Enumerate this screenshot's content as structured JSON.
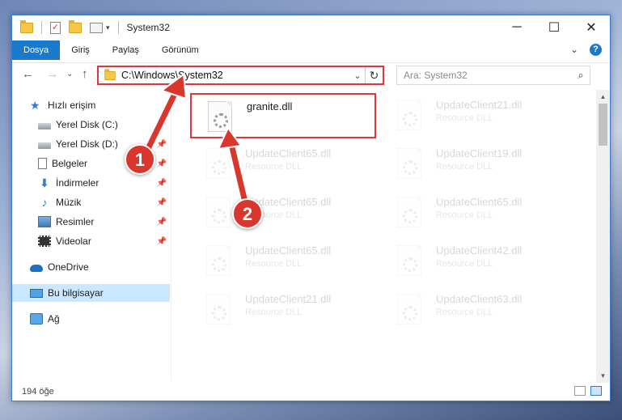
{
  "titlebar": {
    "title": "System32",
    "minimize": "─",
    "maximize": "☐",
    "close": "✕"
  },
  "ribbon": {
    "tabs": [
      "Dosya",
      "Giriş",
      "Paylaş",
      "Görünüm"
    ],
    "expand": "⌄",
    "help": "?"
  },
  "nav": {
    "back": "←",
    "forward": "→",
    "recent": "⌄",
    "up": "↑",
    "address": "C:\\Windows\\System32",
    "refresh": "↻",
    "search_placeholder": "Ara: System32",
    "search_icon": "⌕"
  },
  "sidebar": {
    "items": [
      {
        "label": "Hızlı erişim",
        "icon": "star-icon"
      },
      {
        "label": "Yerel Disk (C:)",
        "icon": "drive-icon"
      },
      {
        "label": "Yerel Disk (D:)",
        "icon": "drive-icon"
      },
      {
        "label": "Belgeler",
        "icon": "document-icon"
      },
      {
        "label": "İndirmeler",
        "icon": "download-icon"
      },
      {
        "label": "Müzik",
        "icon": "music-icon"
      },
      {
        "label": "Resimler",
        "icon": "pictures-icon"
      },
      {
        "label": "Videolar",
        "icon": "video-icon"
      },
      {
        "label": "OneDrive",
        "icon": "cloud-icon"
      },
      {
        "label": "Bu bilgisayar",
        "icon": "computer-icon"
      },
      {
        "label": "Ağ",
        "icon": "network-icon"
      }
    ],
    "pin": "📌",
    "down_arrow": "⬇",
    "music_note": "♪",
    "star": "★"
  },
  "files": [
    {
      "name": "granite.dll",
      "type": "",
      "highlighted": true
    },
    {
      "name": "UpdateClient21.dll",
      "type": "Resource DLL"
    },
    {
      "name": "UpdateClient65.dll",
      "type": "Resource DLL"
    },
    {
      "name": "UpdateClient19.dll",
      "type": "Resource DLL"
    },
    {
      "name": "UpdateClient65.dll",
      "type": "Resource DLL"
    },
    {
      "name": "UpdateClient65.dll",
      "type": "Resource DLL"
    },
    {
      "name": "UpdateClient65.dll",
      "type": "Resource DLL"
    },
    {
      "name": "UpdateClient42.dll",
      "type": "Resource DLL"
    },
    {
      "name": "UpdateClient21.dll",
      "type": "Resource DLL"
    },
    {
      "name": "UpdateClient63.dll",
      "type": "Resource DLL"
    }
  ],
  "scroll": {
    "up": "▲",
    "down": "▼"
  },
  "status": {
    "count": "194 öğe"
  },
  "annotations": {
    "marker1": "1",
    "marker2": "2"
  },
  "colors": {
    "accent": "#1979ca",
    "highlight": "#e0363c",
    "marker": "#d9362d"
  }
}
